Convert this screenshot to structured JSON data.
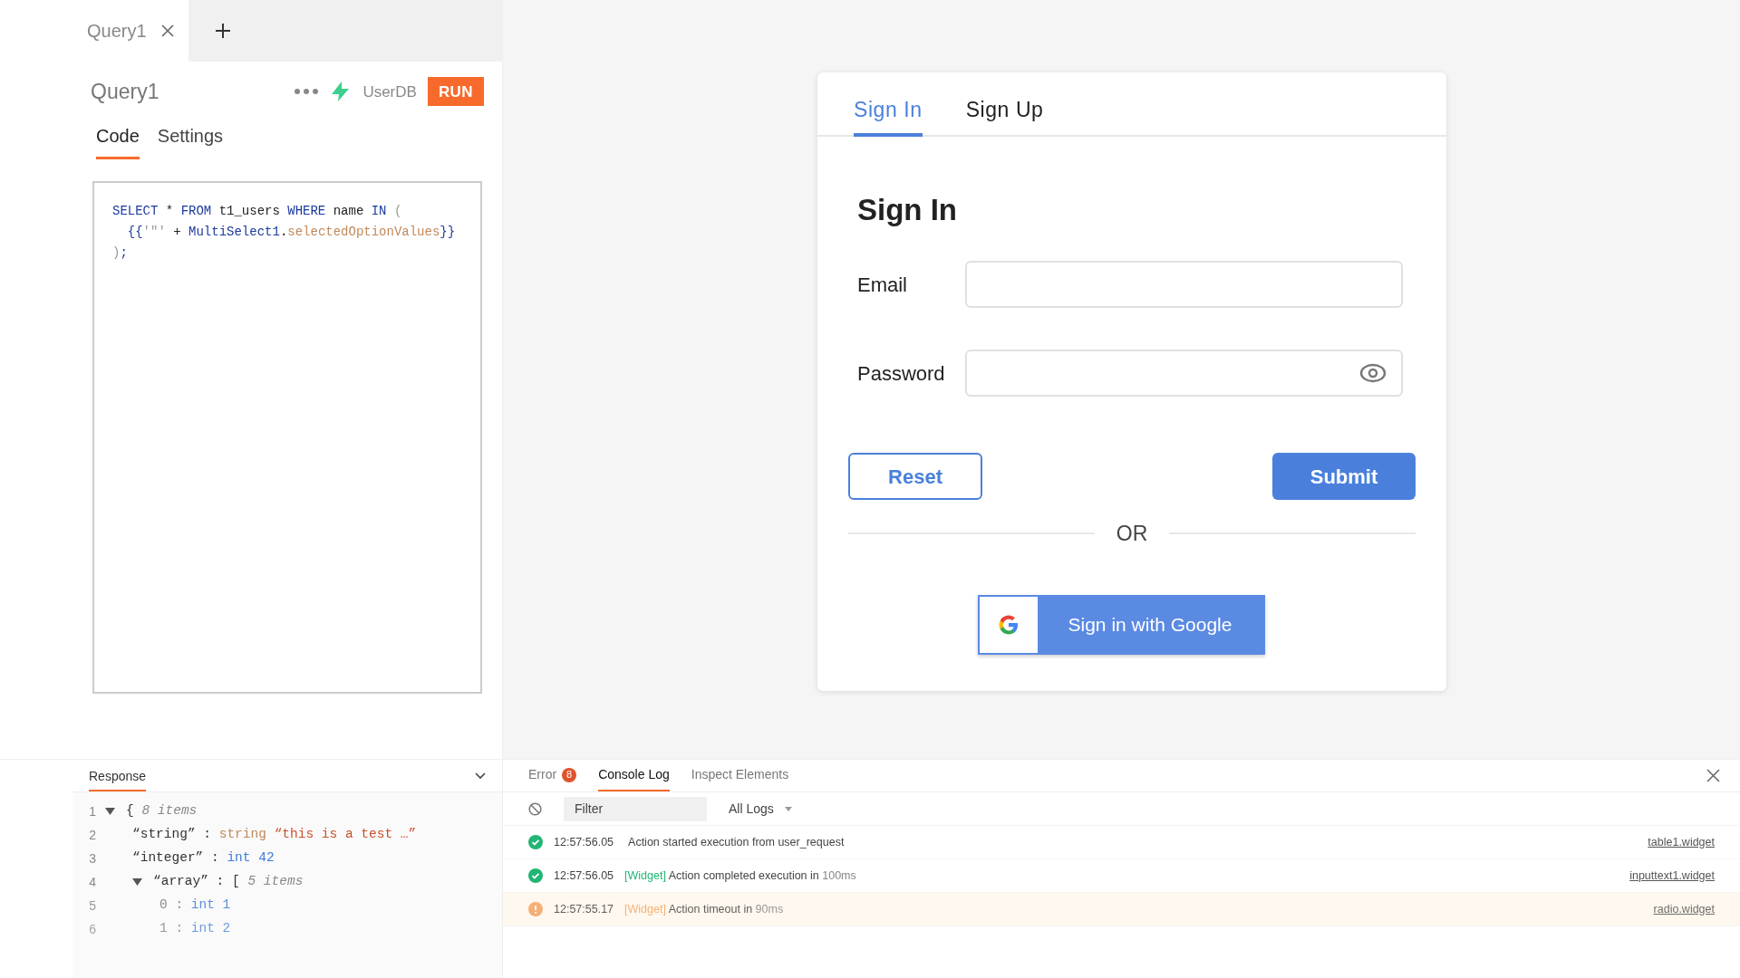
{
  "query_tabs": [
    {
      "label": "Query1",
      "selected": true
    }
  ],
  "query": {
    "title": "Query1",
    "datasource": "UserDB",
    "run_label": "RUN"
  },
  "editor_tabs": [
    {
      "label": "Code",
      "selected": true
    },
    {
      "label": "Settings",
      "selected": false
    }
  ],
  "code": [
    [
      {
        "kind": "kw",
        "text": "SELECT"
      },
      {
        "kind": "plain",
        "text": " * "
      },
      {
        "kind": "kw",
        "text": "FROM"
      },
      {
        "kind": "plain",
        "text": " t1_users "
      },
      {
        "kind": "kw",
        "text": "WHERE"
      },
      {
        "kind": "plain",
        "text": " name "
      },
      {
        "kind": "kw",
        "text": "IN"
      },
      {
        "kind": "punct",
        "text": " ("
      }
    ],
    [
      {
        "kind": "kw",
        "text": "  {{"
      },
      {
        "kind": "punct",
        "text": "'\"'"
      },
      {
        "kind": "plain",
        "text": " + "
      },
      {
        "kind": "kw",
        "text": "MultiSelect1"
      },
      {
        "kind": "plain",
        "text": "."
      },
      {
        "kind": "prop",
        "text": "selectedOptionValues"
      },
      {
        "kind": "kw",
        "text": "}}"
      }
    ],
    [
      {
        "kind": "punct",
        "text": ")"
      },
      {
        "kind": "kw",
        "text": ";"
      }
    ]
  ],
  "response": {
    "title": "Response",
    "lines": [
      {
        "number": "1",
        "toggle": true,
        "parts": [
          {
            "kind": "plain",
            "text": "{ "
          },
          {
            "kind": "note",
            "text": "8 items"
          }
        ]
      },
      {
        "number": "2",
        "parts": [
          {
            "kind": "plain",
            "text": "“string” : "
          },
          {
            "kind": "type",
            "text": "string "
          },
          {
            "kind": "str",
            "text": "“this is a test …”"
          }
        ]
      },
      {
        "number": "3",
        "parts": [
          {
            "kind": "plain",
            "text": "“integer” : "
          },
          {
            "kind": "num",
            "text": "int 42"
          }
        ]
      },
      {
        "number": "4",
        "toggle": true,
        "parts": [
          {
            "kind": "plain",
            "text": "“array” : [ "
          },
          {
            "kind": "note",
            "text": "5 items"
          }
        ]
      },
      {
        "number": "5",
        "parts": [
          {
            "kind": "key",
            "text": "0 : "
          },
          {
            "kind": "num",
            "text": "int 1"
          }
        ]
      },
      {
        "number": "6",
        "parts": [
          {
            "kind": "key",
            "text": "1 : "
          },
          {
            "kind": "num",
            "text": "int 2"
          }
        ]
      }
    ]
  },
  "console": {
    "tabs": [
      {
        "label": "Error",
        "badge": "8",
        "selected": false
      },
      {
        "label": "Console Log",
        "selected": true
      },
      {
        "label": "Inspect Elements",
        "selected": false
      }
    ],
    "filter_placeholder": "Filter",
    "level_select": "All Logs",
    "logs": [
      {
        "kind": "success",
        "time": "12:57:56.05",
        "message": "Action started execution from user_request",
        "source": "table1.widget"
      },
      {
        "kind": "success",
        "time": "12:57:56.05",
        "tag": "[Widget]",
        "message": "Action completed execution in",
        "duration": "100ms",
        "source": "inputtext1.widget"
      },
      {
        "kind": "warning",
        "time": "12:57:55.17",
        "tag": "[Widget]",
        "message": "Action timeout in",
        "duration": "90ms",
        "source": "radio.widget"
      }
    ]
  },
  "form": {
    "tabs": [
      {
        "label": "Sign In",
        "selected": true
      },
      {
        "label": "Sign Up",
        "selected": false
      }
    ],
    "heading": "Sign In",
    "email_label": "Email",
    "password_label": "Password",
    "reset": "Reset",
    "submit": "Submit",
    "divider": "OR",
    "google": "Sign in with Google"
  }
}
